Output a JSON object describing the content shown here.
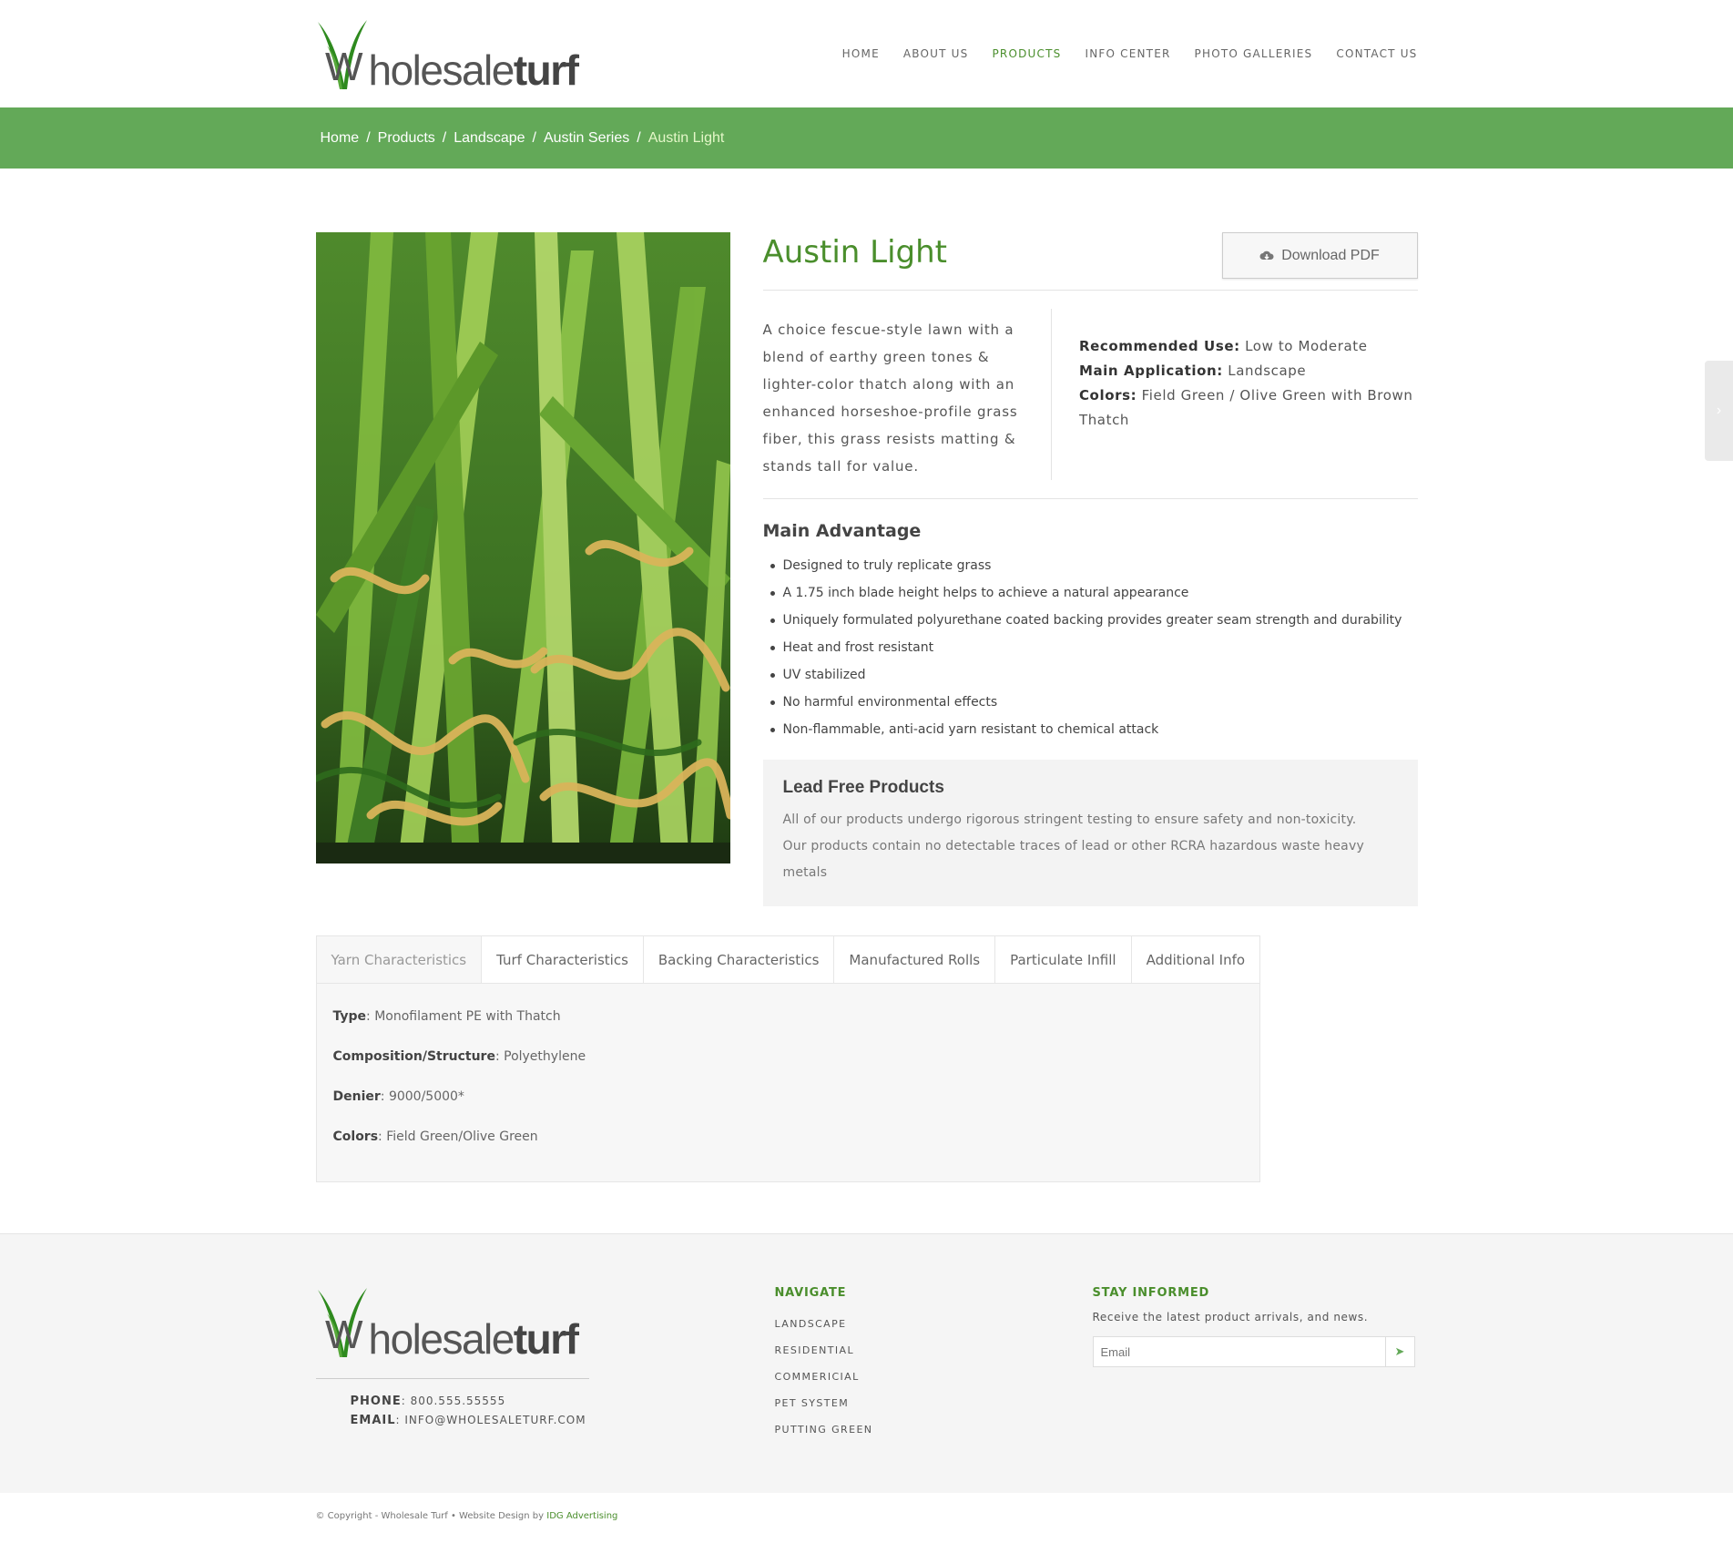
{
  "brand": {
    "logo_prefix": "holesale",
    "logo_suffix": "turf",
    "logo_initial": "W"
  },
  "nav": {
    "items": [
      {
        "label": "HOME"
      },
      {
        "label": "ABOUT US"
      },
      {
        "label": "PRODUCTS",
        "active": true
      },
      {
        "label": "INFO CENTER"
      },
      {
        "label": "PHOTO GALLERIES"
      },
      {
        "label": "CONTACT US"
      }
    ]
  },
  "breadcrumb": {
    "items": [
      "Home",
      "Products",
      "Landscape",
      "Austin Series"
    ],
    "separator": "/",
    "current": "Austin Light"
  },
  "product": {
    "title": "Austin Light",
    "download_label": "Download PDF",
    "description": "A choice fescue-style lawn with a blend of earthy green tones & lighter-color thatch along with an enhanced horseshoe-profile grass fiber, this grass resists matting & stands tall for value.",
    "specs": {
      "recommended_use_label": "Recommended Use:",
      "recommended_use": "Low to Moderate",
      "main_application_label": "Main Application:",
      "main_application": "Landscape",
      "colors_label": "Colors:",
      "colors": "Field Green / Olive Green with Brown Thatch"
    },
    "advantage_title": "Main Advantage",
    "advantages": [
      "Designed to truly replicate grass",
      "A 1.75 inch blade height helps to achieve a natural appearance",
      "Uniquely formulated polyurethane coated backing provides greater seam strength and durability",
      "Heat and frost resistant",
      "UV stabilized",
      "No harmful environmental effects",
      "Non-flammable, anti-acid yarn resistant to chemical attack"
    ],
    "lead": {
      "title": "Lead Free Products",
      "line1": "All of our products undergo rigorous stringent testing to ensure safety and non-toxicity.",
      "line2": "Our products contain no detectable traces of lead or other RCRA hazardous waste heavy metals"
    }
  },
  "tabs": {
    "items": [
      {
        "label": "Yarn Characteristics",
        "active": true
      },
      {
        "label": "Turf Characteristics"
      },
      {
        "label": "Backing Characteristics"
      },
      {
        "label": "Manufactured Rolls"
      },
      {
        "label": "Particulate Infill"
      },
      {
        "label": "Additional Info"
      }
    ],
    "panel": [
      {
        "label": "Type",
        "value": ": Monofilament PE with Thatch"
      },
      {
        "label": "Composition/Structure",
        "value": ": Polyethylene"
      },
      {
        "label": "Denier",
        "value": ": 9000/5000*"
      },
      {
        "label": "Colors",
        "value": ": Field Green/Olive Green"
      }
    ]
  },
  "footer": {
    "phone_label": "PHONE",
    "phone": ": 800.555.55555",
    "email_label": "EMAIL",
    "email": ": INFO@WHOLESALETURF.COM",
    "navigate_heading": "NAVIGATE",
    "navigate": [
      "LANDSCAPE",
      "RESIDENTIAL",
      "COMMERICIAL",
      "PET SYSTEM",
      "PUTTING GREEN"
    ],
    "newsletter_heading": "STAY INFORMED",
    "newsletter_text": "Receive the latest product arrivals, and news.",
    "email_placeholder": "Email",
    "copyright": "© Copyright - Wholesale Turf • Website Design by ",
    "agency": "IDG Advertising"
  },
  "colors": {
    "brand_green": "#4a8e2c",
    "crumb_bar": "#63a958"
  },
  "icons": {
    "download": "cloud-download-icon",
    "send": "send-icon",
    "next": "chevron-right-icon"
  }
}
